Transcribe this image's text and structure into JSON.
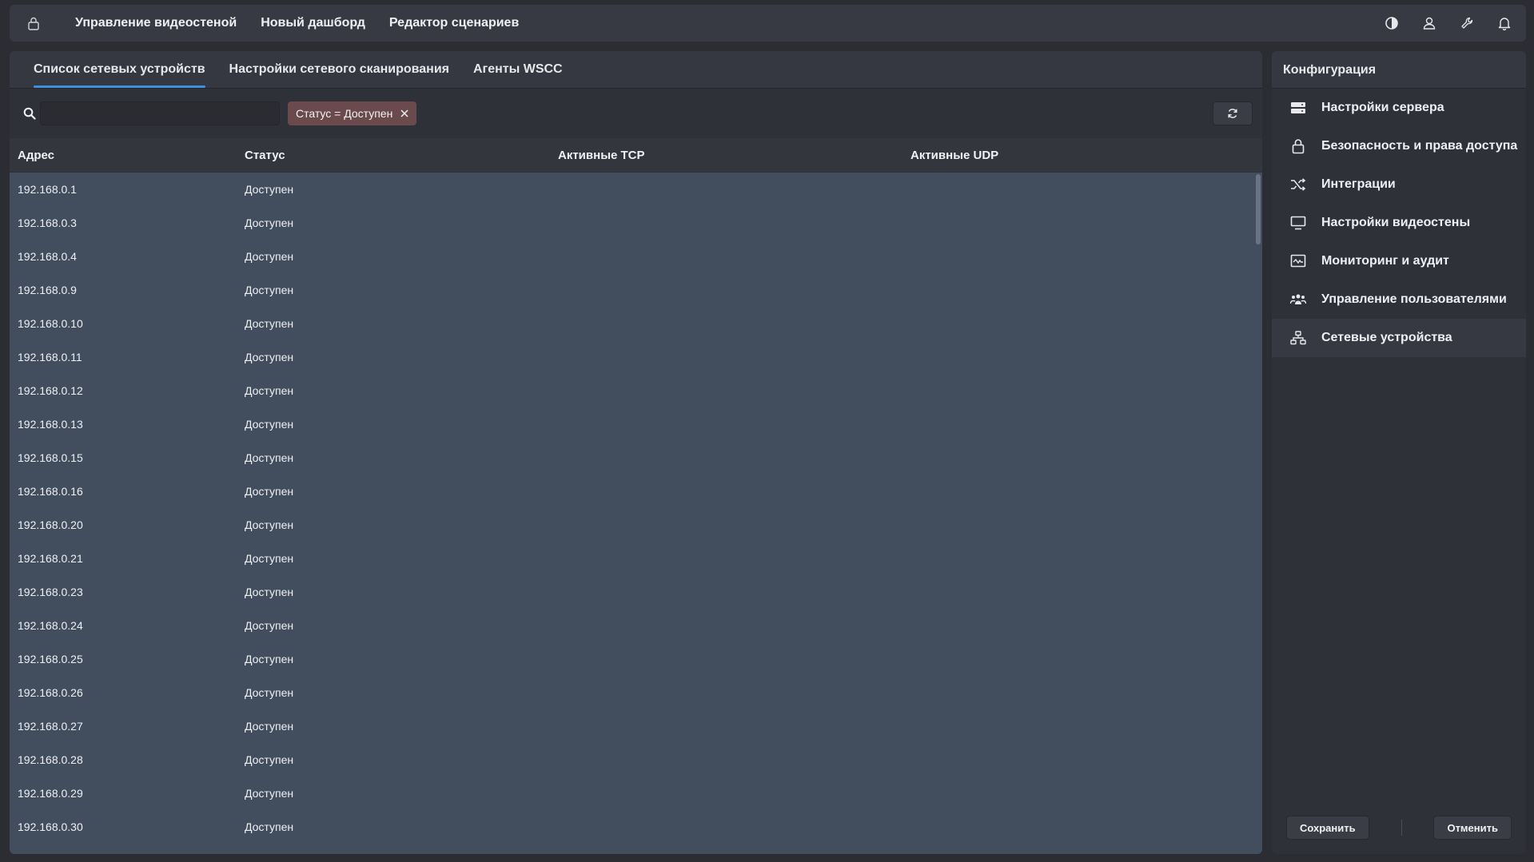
{
  "topbar": {
    "nav": [
      "Управление видеостеной",
      "Новый дашборд",
      "Редактор сценариев"
    ],
    "icons": [
      "lock-icon",
      "contrast-icon",
      "user-icon",
      "wrench-icon",
      "bell-icon"
    ]
  },
  "tabs": [
    {
      "label": "Список сетевых устройств",
      "active": true
    },
    {
      "label": "Настройки сетевого сканирования",
      "active": false
    },
    {
      "label": "Агенты WSCC",
      "active": false
    }
  ],
  "search": {
    "value": "",
    "placeholder": ""
  },
  "filter_chip": {
    "label": "Статус = Доступен"
  },
  "table": {
    "columns": [
      "Адрес",
      "Статус",
      "Активные TCP",
      "Активные UDP"
    ],
    "rows": [
      {
        "address": "192.168.0.1",
        "status": "Доступен"
      },
      {
        "address": "192.168.0.3",
        "status": "Доступен"
      },
      {
        "address": "192.168.0.4",
        "status": "Доступен"
      },
      {
        "address": "192.168.0.9",
        "status": "Доступен"
      },
      {
        "address": "192.168.0.10",
        "status": "Доступен"
      },
      {
        "address": "192.168.0.11",
        "status": "Доступен"
      },
      {
        "address": "192.168.0.12",
        "status": "Доступен"
      },
      {
        "address": "192.168.0.13",
        "status": "Доступен"
      },
      {
        "address": "192.168.0.15",
        "status": "Доступен"
      },
      {
        "address": "192.168.0.16",
        "status": "Доступен"
      },
      {
        "address": "192.168.0.20",
        "status": "Доступен"
      },
      {
        "address": "192.168.0.21",
        "status": "Доступен"
      },
      {
        "address": "192.168.0.23",
        "status": "Доступен"
      },
      {
        "address": "192.168.0.24",
        "status": "Доступен"
      },
      {
        "address": "192.168.0.25",
        "status": "Доступен"
      },
      {
        "address": "192.168.0.26",
        "status": "Доступен"
      },
      {
        "address": "192.168.0.27",
        "status": "Доступен"
      },
      {
        "address": "192.168.0.28",
        "status": "Доступен"
      },
      {
        "address": "192.168.0.29",
        "status": "Доступен"
      },
      {
        "address": "192.168.0.30",
        "status": "Доступен"
      }
    ]
  },
  "config": {
    "title": "Конфигурация",
    "items": [
      {
        "label": "Настройки сервера",
        "icon": "server-icon"
      },
      {
        "label": "Безопасность и права доступа",
        "icon": "lock-icon"
      },
      {
        "label": "Интеграции",
        "icon": "shuffle-icon"
      },
      {
        "label": "Настройки видеостены",
        "icon": "monitor-icon"
      },
      {
        "label": "Мониторинг и аудит",
        "icon": "activity-icon"
      },
      {
        "label": "Управление пользователями",
        "icon": "users-icon"
      },
      {
        "label": "Сетевые устройства",
        "icon": "network-icon",
        "active": true
      }
    ],
    "save_label": "Сохранить",
    "cancel_label": "Отменить"
  },
  "colors": {
    "accent": "#3f8fe0",
    "chip": "#6a4a4c",
    "table_bg": "#424e5e"
  }
}
